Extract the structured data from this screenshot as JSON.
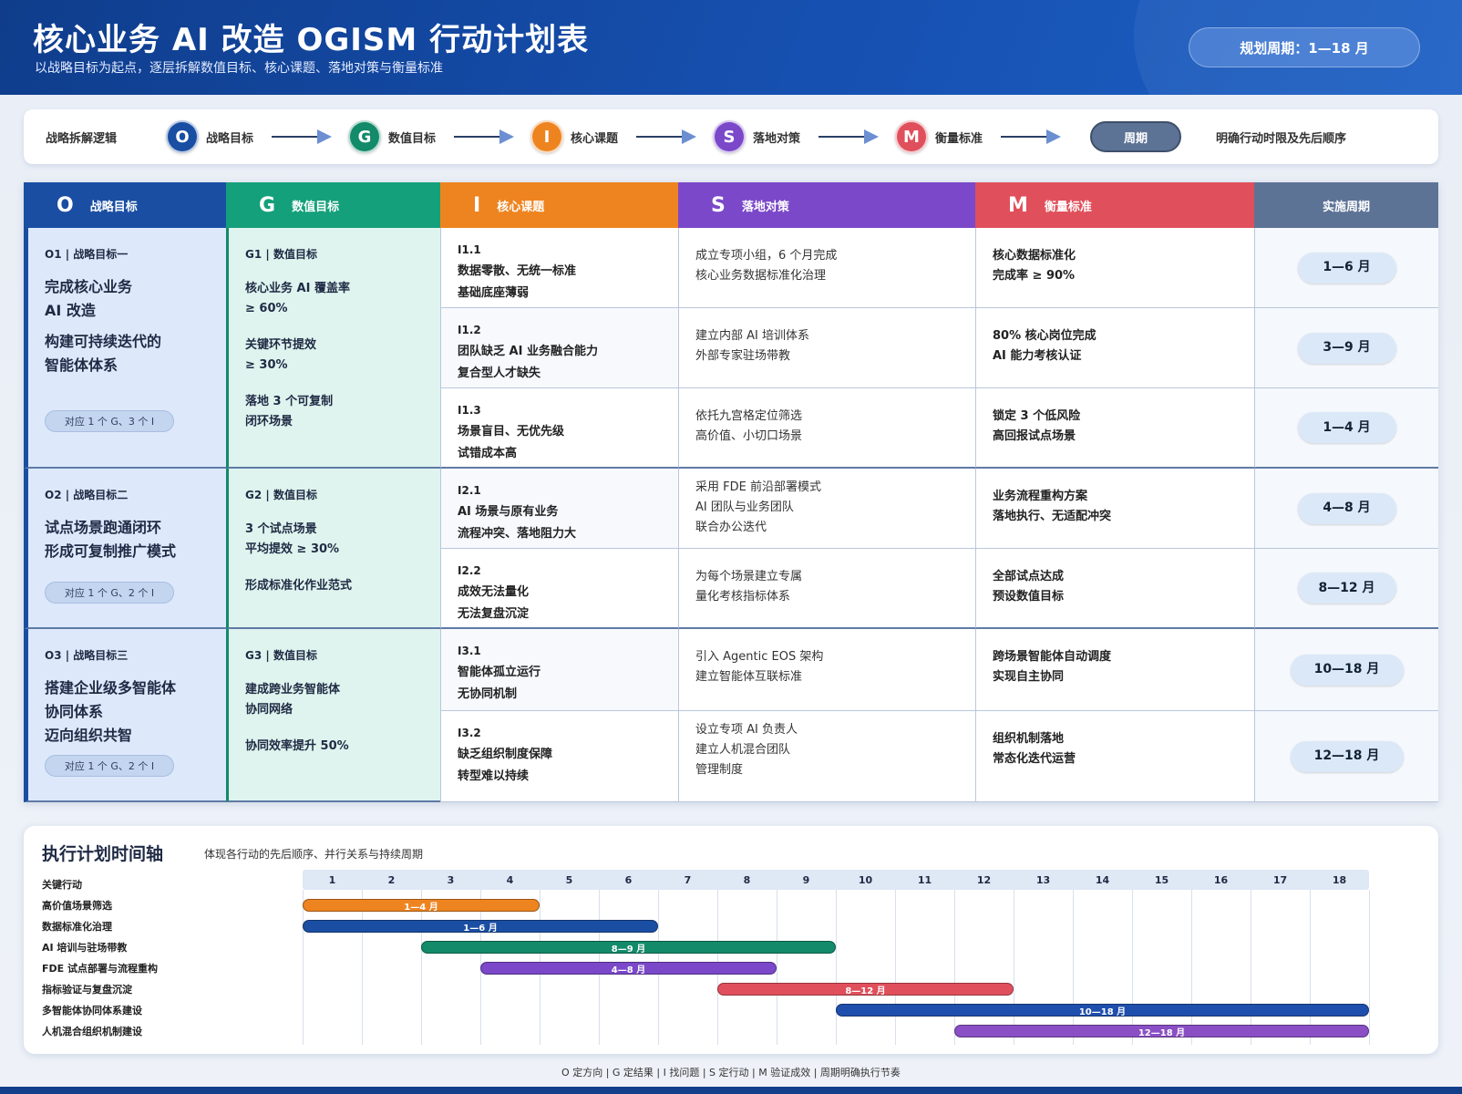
{
  "header": {
    "title": "核心业务 AI 改造 OGISM 行动计划表",
    "subtitle": "以战略目标为起点，逐层拆解数值目标、核心课题、落地对策与衡量标准",
    "period": "规划周期：1—18 月"
  },
  "logic": {
    "label": "战略拆解逻辑",
    "steps": [
      {
        "letter": "O",
        "label": "战略目标",
        "color": "#1a4ea3"
      },
      {
        "letter": "G",
        "label": "数值目标",
        "color": "#138a69"
      },
      {
        "letter": "I",
        "label": "核心课题",
        "color": "#ee8420"
      },
      {
        "letter": "S",
        "label": "落地对策",
        "color": "#7a48c9"
      },
      {
        "letter": "M",
        "label": "衡量标准",
        "color": "#e0505c"
      }
    ],
    "period_chip": "周期",
    "note": "明确行动时限及先后顺序"
  },
  "table": {
    "headers": [
      {
        "letter": "O",
        "label": "战略目标",
        "color": "#1a4ea3"
      },
      {
        "letter": "G",
        "label": "数值目标",
        "color": "#14a07a"
      },
      {
        "letter": "I",
        "label": "核心课题",
        "color": "#ee8420"
      },
      {
        "letter": "S",
        "label": "落地对策",
        "color": "#7a48c9"
      },
      {
        "letter": "M",
        "label": "衡量标准",
        "color": "#e0505c"
      },
      {
        "letter": "",
        "label": "实施周期",
        "color": "#5d7396"
      }
    ],
    "objectives": [
      {
        "head": "O1 | 战略目标一",
        "text1": "完成核心业务",
        "text2": "AI 改造",
        "text3": "构建可持续迭代的",
        "text4": "智能体体系",
        "chip": "对应 1 个 G、3 个 I"
      },
      {
        "head": "O2 | 战略目标二",
        "text1": "试点场景跑通闭环",
        "text2": "形成可复制推广模式",
        "chip": "对应 1 个 G、2 个 I"
      },
      {
        "head": "O3 | 战略目标三",
        "text1": "搭建企业级多智能体",
        "text2": "协同体系",
        "text3": "迈向组织共智",
        "chip": "对应 1 个 G、2 个 I"
      }
    ],
    "goals": [
      {
        "head": "G1 | 数值目标",
        "l1": "核心业务 AI 覆盖率",
        "l2": "≥ 60%",
        "l3": "关键环节提效",
        "l4": "≥ 30%",
        "l5": "落地 3 个可复制",
        "l6": "闭环场景"
      },
      {
        "head": "G2 | 数值目标",
        "l1": "3 个试点场景",
        "l2": "平均提效 ≥ 30%",
        "l3": "形成标准化作业范式"
      },
      {
        "head": "G3 | 数值目标",
        "l1": "建成跨业务智能体",
        "l2": "协同网络",
        "l3": "协同效率提升 50%"
      }
    ],
    "rows": [
      {
        "code": "I1.1",
        "i1": "数据零散、无统一标准",
        "i2": "基础底座薄弱",
        "s1": "成立专项小组，6 个月完成",
        "s2": "核心业务数据标准化治理",
        "s3": "",
        "m1": "核心数据标准化",
        "m2": "完成率 ≥ 90%",
        "period": "1—6 月"
      },
      {
        "code": "I1.2",
        "i1": "团队缺乏 AI 业务融合能力",
        "i2": "复合型人才缺失",
        "s1": "建立内部 AI 培训体系",
        "s2": "外部专家驻场带教",
        "s3": "",
        "m1": "80% 核心岗位完成",
        "m2": "AI 能力考核认证",
        "period": "3—9 月"
      },
      {
        "code": "I1.3",
        "i1": "场景盲目、无优先级",
        "i2": "试错成本高",
        "s1": "依托九宫格定位筛选",
        "s2": "高价值、小切口场景",
        "s3": "",
        "m1": "锁定 3 个低风险",
        "m2": "高回报试点场景",
        "period": "1—4 月"
      },
      {
        "code": "I2.1",
        "i1": "AI 场景与原有业务",
        "i2": "流程冲突、落地阻力大",
        "s1": "采用 FDE 前沿部署模式",
        "s2": "AI 团队与业务团队",
        "s3": "联合办公迭代",
        "m1": "业务流程重构方案",
        "m2": "落地执行、无适配冲突",
        "period": "4—8 月"
      },
      {
        "code": "I2.2",
        "i1": "成效无法量化",
        "i2": "无法复盘沉淀",
        "s1": "为每个场景建立专属",
        "s2": "量化考核指标体系",
        "s3": "",
        "m1": "全部试点达成",
        "m2": "预设数值目标",
        "period": "8—12 月"
      },
      {
        "code": "I3.1",
        "i1": "智能体孤立运行",
        "i2": "无协同机制",
        "s1": "引入 Agentic EOS 架构",
        "s2": "建立智能体互联标准",
        "s3": "",
        "m1": "跨场景智能体自动调度",
        "m2": "实现自主协同",
        "period": "10—18 月"
      },
      {
        "code": "I3.2",
        "i1": "缺乏组织制度保障",
        "i2": "转型难以持续",
        "s1": "设立专项 AI 负责人",
        "s2": "建立人机混合团队",
        "s3": "管理制度",
        "m1": "组织机制落地",
        "m2": "常态化迭代运营",
        "period": "12—18 月"
      }
    ]
  },
  "timeline": {
    "title": "执行计划时间轴",
    "subtitle": "体现各行动的先后顺序、并行关系与持续周期",
    "header_label": "关键行动",
    "months": [
      "1",
      "2",
      "3",
      "4",
      "5",
      "6",
      "7",
      "8",
      "9",
      "10",
      "11",
      "12",
      "13",
      "14",
      "15",
      "16",
      "17",
      "18"
    ],
    "tasks": [
      {
        "name": "高价值场景筛选",
        "start": 1,
        "end": 4,
        "label": "1—4 月",
        "color": "#ee8420"
      },
      {
        "name": "数据标准化治理",
        "start": 1,
        "end": 6,
        "label": "1—6 月",
        "color": "#1a4ea3"
      },
      {
        "name": "AI 培训与驻场带教",
        "start": 3,
        "end": 9,
        "label": "8—9 月",
        "color": "#138a69"
      },
      {
        "name": "FDE 试点部署与流程重构",
        "start": 4,
        "end": 8,
        "label": "4—8 月",
        "color": "#7a48c9"
      },
      {
        "name": "指标验证与复盘沉淀",
        "start": 8,
        "end": 12,
        "label": "8—12 月",
        "color": "#e0505c"
      },
      {
        "name": "多智能体协同体系建设",
        "start": 10,
        "end": 18,
        "label": "10—18 月",
        "color": "#1f4fad"
      },
      {
        "name": "人机混合组织机制建设",
        "start": 12,
        "end": 18,
        "label": "12—18 月",
        "color": "#8a4fc4"
      }
    ]
  },
  "footer": "O 定方向 | G 定结果 | I 找问题 | S 定行动 | M 验证成效 | 周期明确执行节奏"
}
